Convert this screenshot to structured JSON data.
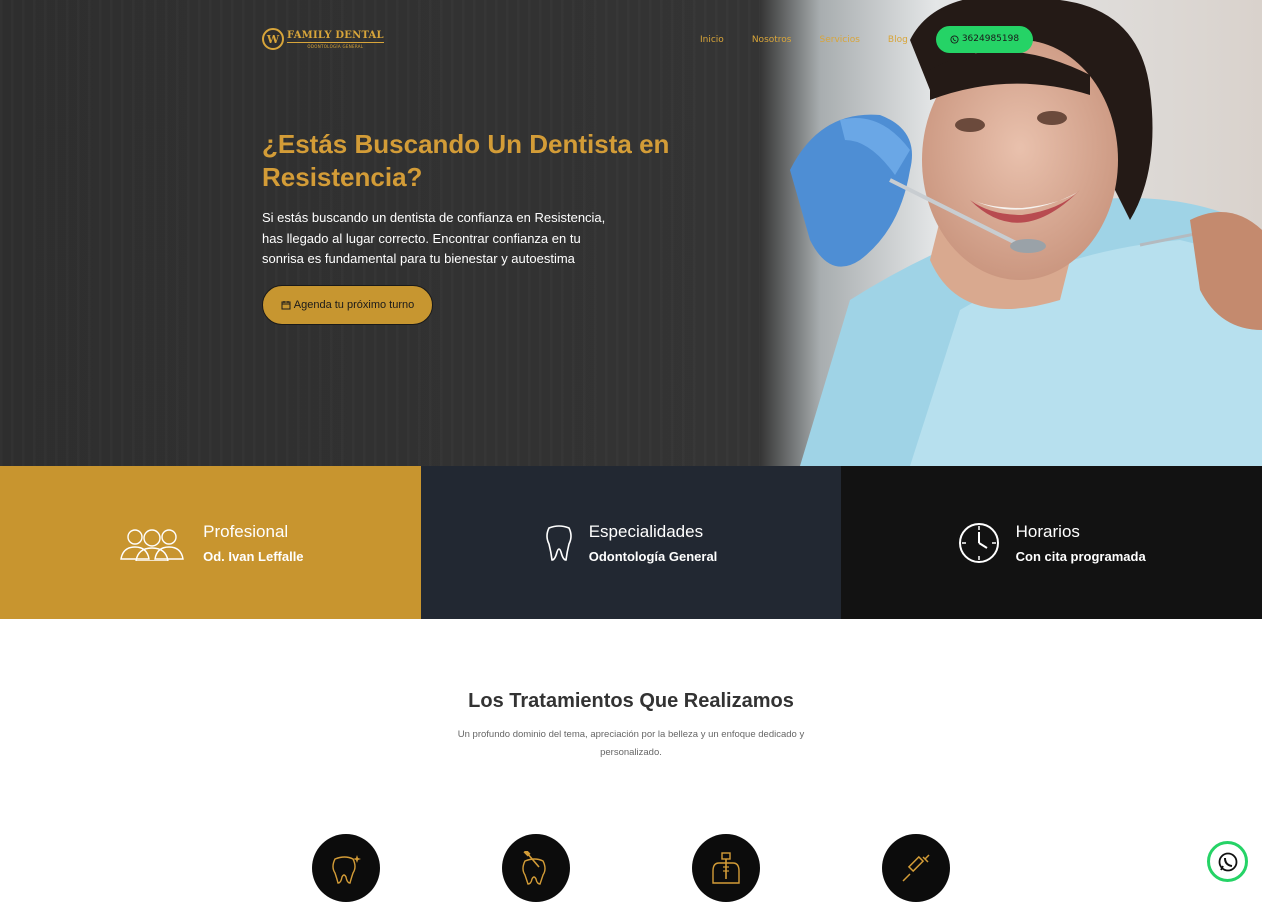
{
  "brand": {
    "logo_letter": "W",
    "name": "FAMILY DENTAL",
    "tagline": "ODONTOLOGÍA GENERAL"
  },
  "nav": {
    "items": [
      "Inicio",
      "Nosotros",
      "Servicios",
      "Blog"
    ],
    "phone_button": "3624985198"
  },
  "hero": {
    "title": "¿Estás Buscando Un Dentista en Resistencia?",
    "text": "Si estás buscando un dentista de confianza en Resistencia, has llegado al lugar correcto. Encontrar confianza en tu sonrisa es fundamental para tu bienestar y autoestima",
    "cta": "Agenda tu próximo turno"
  },
  "info_cards": [
    {
      "title": "Profesional",
      "subtitle": "Od. Ivan Leffalle",
      "icon": "team-icon"
    },
    {
      "title": "Especialidades",
      "subtitle": "Odontología General",
      "icon": "tooth-icon"
    },
    {
      "title": "Horarios",
      "subtitle": "Con cita programada",
      "icon": "clock-icon"
    }
  ],
  "treatments": {
    "title": "Los Tratamientos Que Realizamos",
    "subtitle": "Un profundo dominio del tema, apreciación por la belleza y un enfoque dedicado y personalizado.",
    "icons": [
      "sparkle-tooth-icon",
      "brush-tooth-icon",
      "implant-icon",
      "syringe-icon"
    ]
  },
  "colors": {
    "gold": "#c8952f",
    "gold_text": "#d39c37",
    "whatsapp": "#25d366",
    "navy": "#222832",
    "black": "#121212"
  }
}
